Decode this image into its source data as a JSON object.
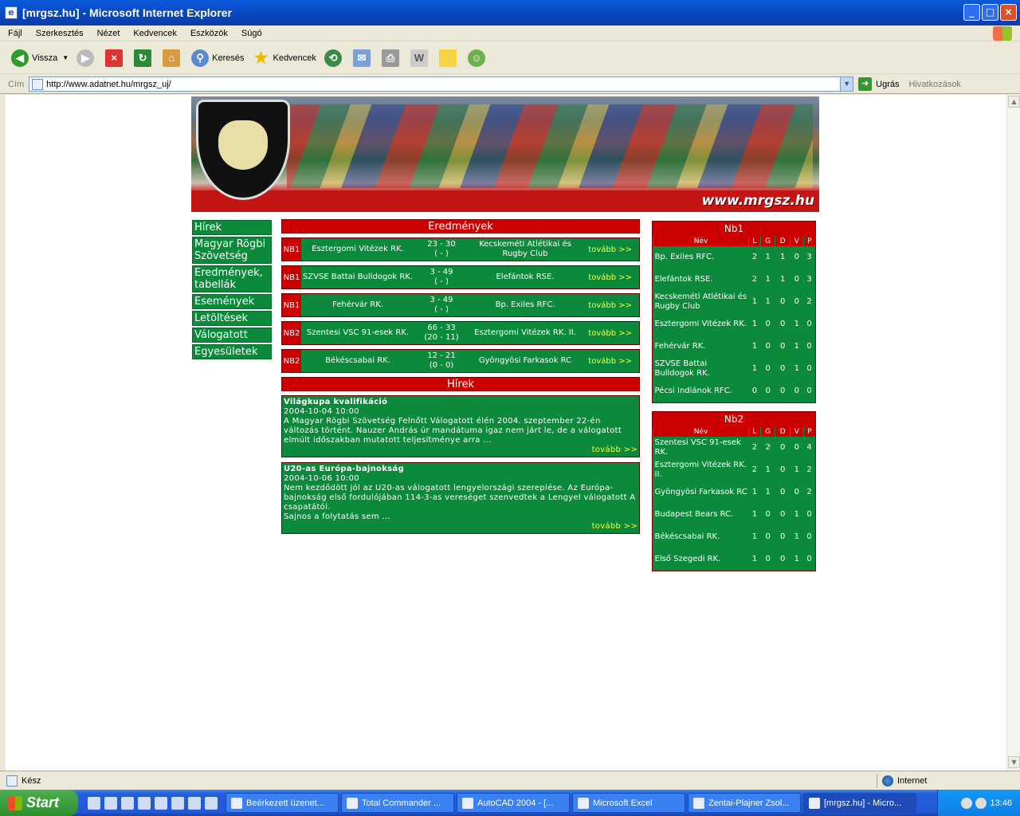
{
  "window": {
    "title": "[mrgsz.hu] - Microsoft Internet Explorer"
  },
  "menu": [
    "Fájl",
    "Szerkesztés",
    "Nézet",
    "Kedvencek",
    "Eszközök",
    "Súgó"
  ],
  "toolbar": {
    "back": "Vissza",
    "search": "Keresés",
    "favorites": "Kedvencek"
  },
  "address": {
    "label": "Cím",
    "url": "http://www.adatnet.hu/mrgsz_uj/",
    "go": "Ugrás",
    "links": "Hivatkozások"
  },
  "banner": {
    "url": "www.mrgsz.hu"
  },
  "nav": [
    "Hírek",
    "Magyar Rögbi Szövetség",
    "Eredmények, tabellák",
    "Események",
    "Letöltések",
    "Válogatott",
    "Egyesületek"
  ],
  "results": {
    "title": "Eredmények",
    "matches": [
      {
        "league": "NB1",
        "home": "Esztergomi Vitézek RK.",
        "score": "23 - 30",
        "half": "( - )",
        "away": "Kecskeméti Atlétikai és Rugby Club",
        "more": "tovább >>"
      },
      {
        "league": "NB1",
        "home": "SZVSE Battai Bulldogok RK.",
        "score": "3 - 49",
        "half": "( - )",
        "away": "Elefántok RSE.",
        "more": "tovább >>"
      },
      {
        "league": "NB1",
        "home": "Fehérvár RK.",
        "score": "3 - 49",
        "half": "( - )",
        "away": "Bp. Exiles RFC.",
        "more": "tovább >>"
      },
      {
        "league": "NB2",
        "home": "Szentesi VSC 91-esek RK.",
        "score": "66 - 33",
        "half": "(20 - 11)",
        "away": "Esztergomi Vitézek RK. II.",
        "more": "tovább >>"
      },
      {
        "league": "NB2",
        "home": "Békéscsabai RK.",
        "score": "12 - 21",
        "half": "(0 - 0)",
        "away": "Gyöngyösi Farkasok RC",
        "more": "tovább >>"
      }
    ]
  },
  "news": {
    "title": "Hírek",
    "items": [
      {
        "title": "Világkupa kvalifikáció",
        "date": "2004-10-04 10:00",
        "text": "A Magyar Rögbi Szövetség Felnőtt Válogatott élén 2004. szeptember 22-én változás történt. Nauzer András úr mandátuma igaz nem járt le, de a válogatott elmúlt időszakban mutatott teljesítménye arra ...",
        "more": "tovább >>"
      },
      {
        "title": "U20-as Európa-bajnokság",
        "date": "2004-10-06 10:00",
        "text": "Nem kezdődött jól az U20-as válogatott lengyelországi szereplése. Az Európa-bajnokság első fordulójában 114-3-as vereséget szenvedtek a Lengyel válogatott A csapatától.",
        "text2": "Sajnos a folytatás sem ...",
        "more": "tovább >>"
      }
    ]
  },
  "tables": [
    {
      "title": "Nb1",
      "cols": [
        "Név",
        "L",
        "G",
        "D",
        "V",
        "P"
      ],
      "rows": [
        [
          "Bp. Exiles RFC.",
          "2",
          "1",
          "1",
          "0",
          "3"
        ],
        [
          "Elefántok RSE.",
          "2",
          "1",
          "1",
          "0",
          "3"
        ],
        [
          "Kecskeméti Atlétikai és Rugby Club",
          "1",
          "1",
          "0",
          "0",
          "2"
        ],
        [
          "Esztergomi Vitézek RK.",
          "1",
          "0",
          "0",
          "1",
          "0"
        ],
        [
          "Fehérvár RK.",
          "1",
          "0",
          "0",
          "1",
          "0"
        ],
        [
          "SZVSE Battai Bulldogok RK.",
          "1",
          "0",
          "0",
          "1",
          "0"
        ],
        [
          "Pécsi Indiánok RFC.",
          "0",
          "0",
          "0",
          "0",
          "0"
        ]
      ]
    },
    {
      "title": "Nb2",
      "cols": [
        "Név",
        "L",
        "G",
        "D",
        "V",
        "P"
      ],
      "rows": [
        [
          "Szentesi VSC 91-esek RK.",
          "2",
          "2",
          "0",
          "0",
          "4"
        ],
        [
          "Esztergomi Vitézek RK. II.",
          "2",
          "1",
          "0",
          "1",
          "2"
        ],
        [
          "Gyöngyösi Farkasok RC",
          "1",
          "1",
          "0",
          "0",
          "2"
        ],
        [
          "Budapest Bears RC.",
          "1",
          "0",
          "0",
          "1",
          "0"
        ],
        [
          "Békéscsabai RK.",
          "1",
          "0",
          "0",
          "1",
          "0"
        ],
        [
          "Első Szegedi RK.",
          "1",
          "0",
          "0",
          "1",
          "0"
        ]
      ]
    }
  ],
  "status": {
    "text": "Kész",
    "zone": "Internet"
  },
  "taskbar": {
    "start": "Start",
    "tasks": [
      "Beérkezett üzenet...",
      "Total Commander ...",
      "AutoCAD 2004 - [...",
      "Microsoft Excel",
      "Zentai-Plajner Zsol...",
      "[mrgsz.hu] - Micro..."
    ],
    "clock": "13:46"
  }
}
